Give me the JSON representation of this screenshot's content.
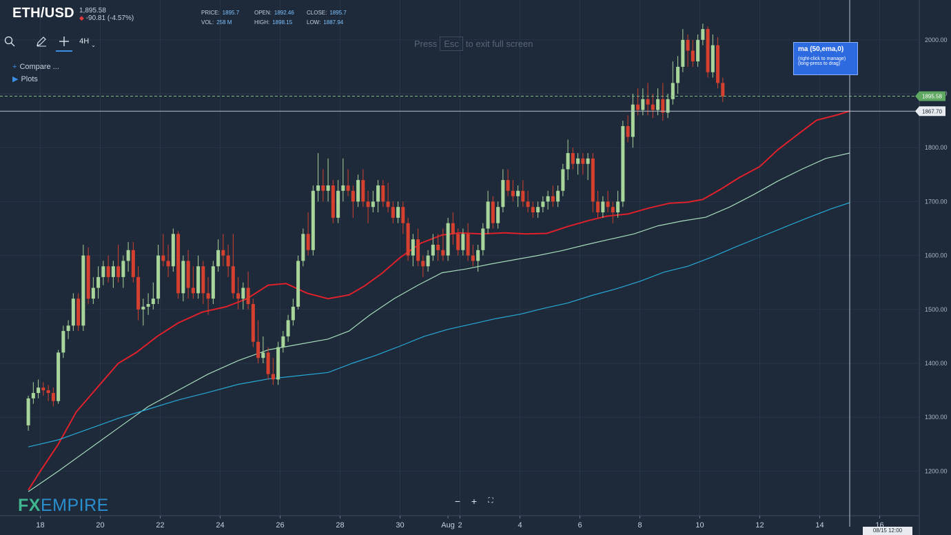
{
  "header": {
    "symbol": "ETH/USD",
    "price": "1,895.58",
    "change": "-90.81 (-4.57%)",
    "change_arrow": "down-arrow-icon",
    "price_label": "PRICE:",
    "price_value": "1895.7",
    "open_label": "OPEN:",
    "open_value": "1892.46",
    "close_label": "CLOSE:",
    "close_value": "1895.7",
    "vol_label": "VOL:",
    "vol_value": "258 M",
    "high_label": "HIGH:",
    "high_value": "1898.15",
    "low_label": "LOW:",
    "low_value": "1887.94"
  },
  "toolbar": {
    "search_icon": "search-icon",
    "draw_icon": "pencil-icon",
    "crosshair_icon": "crosshair-icon",
    "interval": "4H"
  },
  "side": {
    "compare": "Compare ...",
    "plots": "Plots"
  },
  "fullscreen_note": {
    "pre": "Press",
    "key": "Esc",
    "post": "to exit full screen"
  },
  "tooltip": {
    "title": "ma (50,ema,0)",
    "line1": "(right-click to manage)",
    "line2": "(long-press to drag)"
  },
  "logo": {
    "fx": "FX",
    "empire": "EMPIRE"
  },
  "price_tags": {
    "last": "1895.58",
    "crosshair": "1867.70"
  },
  "crosshair_date": "08/15 12:00",
  "colors": {
    "background": "#1e2a3a",
    "up": "#a8d59a",
    "down": "#d6402f",
    "ema50": "#e0202a",
    "ma100": "#a6dcbc",
    "ma200": "#27a9d8"
  },
  "chart_data": {
    "type": "candlestick",
    "ylim": [
      1150,
      2030
    ],
    "y_ticks": [
      1200,
      1300,
      1400,
      1500,
      1600,
      1700,
      1800,
      1900,
      2000
    ],
    "x_ticks": [
      "18",
      "20",
      "22",
      "24",
      "26",
      "28",
      "30",
      "Aug",
      "2",
      "4",
      "6",
      "8",
      "10",
      "12",
      "14",
      "16"
    ],
    "x_tick_days": [
      17,
      19,
      21,
      23,
      25,
      27,
      29,
      30.6,
      31,
      33,
      35,
      37,
      39,
      41,
      43,
      45
    ],
    "grid": true,
    "candle_period_hours": 4,
    "first_candle_day": 16.6,
    "candles": [
      [
        1285,
        1340,
        1275,
        1335
      ],
      [
        1335,
        1365,
        1325,
        1345
      ],
      [
        1345,
        1370,
        1335,
        1355
      ],
      [
        1355,
        1365,
        1340,
        1350
      ],
      [
        1350,
        1360,
        1330,
        1345
      ],
      [
        1345,
        1355,
        1320,
        1330
      ],
      [
        1330,
        1425,
        1325,
        1420
      ],
      [
        1420,
        1470,
        1410,
        1460
      ],
      [
        1460,
        1480,
        1445,
        1470
      ],
      [
        1470,
        1530,
        1460,
        1520
      ],
      [
        1520,
        1530,
        1460,
        1470
      ],
      [
        1470,
        1620,
        1460,
        1600
      ],
      [
        1600,
        1615,
        1510,
        1520
      ],
      [
        1520,
        1560,
        1510,
        1540
      ],
      [
        1540,
        1580,
        1520,
        1560
      ],
      [
        1560,
        1590,
        1545,
        1580
      ],
      [
        1580,
        1600,
        1550,
        1560
      ],
      [
        1560,
        1590,
        1540,
        1580
      ],
      [
        1580,
        1620,
        1550,
        1560
      ],
      [
        1560,
        1600,
        1540,
        1590
      ],
      [
        1590,
        1625,
        1570,
        1610
      ],
      [
        1610,
        1625,
        1550,
        1560
      ],
      [
        1560,
        1580,
        1480,
        1500
      ],
      [
        1500,
        1520,
        1470,
        1505
      ],
      [
        1505,
        1530,
        1490,
        1510
      ],
      [
        1510,
        1550,
        1500,
        1520
      ],
      [
        1520,
        1620,
        1510,
        1600
      ],
      [
        1600,
        1640,
        1580,
        1590
      ],
      [
        1590,
        1620,
        1560,
        1580
      ],
      [
        1580,
        1650,
        1570,
        1640
      ],
      [
        1640,
        1645,
        1520,
        1530
      ],
      [
        1530,
        1600,
        1515,
        1590
      ],
      [
        1590,
        1610,
        1520,
        1540
      ],
      [
        1540,
        1580,
        1520,
        1530
      ],
      [
        1530,
        1600,
        1520,
        1580
      ],
      [
        1580,
        1590,
        1510,
        1530
      ],
      [
        1530,
        1560,
        1490,
        1520
      ],
      [
        1520,
        1590,
        1510,
        1580
      ],
      [
        1580,
        1630,
        1570,
        1610
      ],
      [
        1610,
        1640,
        1580,
        1600
      ],
      [
        1600,
        1620,
        1560,
        1580
      ],
      [
        1580,
        1640,
        1520,
        1530
      ],
      [
        1530,
        1560,
        1500,
        1520
      ],
      [
        1520,
        1550,
        1500,
        1540
      ],
      [
        1540,
        1570,
        1500,
        1510
      ],
      [
        1510,
        1520,
        1430,
        1440
      ],
      [
        1440,
        1480,
        1400,
        1410
      ],
      [
        1410,
        1450,
        1400,
        1420
      ],
      [
        1420,
        1430,
        1370,
        1380
      ],
      [
        1380,
        1410,
        1360,
        1370
      ],
      [
        1370,
        1440,
        1360,
        1430
      ],
      [
        1430,
        1460,
        1420,
        1450
      ],
      [
        1450,
        1490,
        1440,
        1480
      ],
      [
        1480,
        1520,
        1470,
        1505
      ],
      [
        1505,
        1600,
        1500,
        1590
      ],
      [
        1590,
        1650,
        1580,
        1640
      ],
      [
        1640,
        1680,
        1600,
        1610
      ],
      [
        1610,
        1730,
        1600,
        1720
      ],
      [
        1720,
        1790,
        1700,
        1730
      ],
      [
        1730,
        1760,
        1700,
        1720
      ],
      [
        1720,
        1780,
        1700,
        1730
      ],
      [
        1730,
        1740,
        1660,
        1670
      ],
      [
        1670,
        1740,
        1660,
        1720
      ],
      [
        1720,
        1780,
        1700,
        1730
      ],
      [
        1730,
        1760,
        1710,
        1720
      ],
      [
        1720,
        1730,
        1670,
        1700
      ],
      [
        1700,
        1750,
        1690,
        1740
      ],
      [
        1740,
        1760,
        1690,
        1700
      ],
      [
        1700,
        1720,
        1660,
        1690
      ],
      [
        1690,
        1720,
        1680,
        1700
      ],
      [
        1700,
        1740,
        1680,
        1730
      ],
      [
        1730,
        1740,
        1690,
        1700
      ],
      [
        1700,
        1735,
        1680,
        1690
      ],
      [
        1690,
        1700,
        1660,
        1670
      ],
      [
        1670,
        1700,
        1660,
        1690
      ],
      [
        1690,
        1700,
        1640,
        1660
      ],
      [
        1660,
        1670,
        1590,
        1600
      ],
      [
        1600,
        1640,
        1580,
        1630
      ],
      [
        1630,
        1650,
        1580,
        1590
      ],
      [
        1590,
        1600,
        1560,
        1580
      ],
      [
        1580,
        1610,
        1570,
        1600
      ],
      [
        1600,
        1640,
        1590,
        1620
      ],
      [
        1620,
        1640,
        1590,
        1610
      ],
      [
        1610,
        1650,
        1590,
        1600
      ],
      [
        1600,
        1670,
        1590,
        1660
      ],
      [
        1660,
        1680,
        1620,
        1640
      ],
      [
        1640,
        1650,
        1600,
        1610
      ],
      [
        1610,
        1650,
        1600,
        1640
      ],
      [
        1640,
        1660,
        1590,
        1600
      ],
      [
        1600,
        1620,
        1580,
        1590
      ],
      [
        1590,
        1620,
        1570,
        1610
      ],
      [
        1610,
        1660,
        1600,
        1650
      ],
      [
        1650,
        1720,
        1640,
        1700
      ],
      [
        1700,
        1710,
        1650,
        1660
      ],
      [
        1660,
        1700,
        1650,
        1690
      ],
      [
        1690,
        1760,
        1680,
        1740
      ],
      [
        1740,
        1760,
        1710,
        1720
      ],
      [
        1720,
        1740,
        1700,
        1710
      ],
      [
        1710,
        1730,
        1690,
        1720
      ],
      [
        1720,
        1740,
        1690,
        1700
      ],
      [
        1700,
        1720,
        1680,
        1690
      ],
      [
        1690,
        1700,
        1670,
        1680
      ],
      [
        1680,
        1700,
        1670,
        1690
      ],
      [
        1690,
        1710,
        1680,
        1700
      ],
      [
        1700,
        1720,
        1685,
        1710
      ],
      [
        1710,
        1730,
        1690,
        1700
      ],
      [
        1700,
        1730,
        1690,
        1720
      ],
      [
        1720,
        1770,
        1710,
        1760
      ],
      [
        1760,
        1815,
        1740,
        1790
      ],
      [
        1790,
        1800,
        1760,
        1770
      ],
      [
        1770,
        1790,
        1750,
        1780
      ],
      [
        1780,
        1790,
        1750,
        1770
      ],
      [
        1770,
        1790,
        1740,
        1780
      ],
      [
        1780,
        1790,
        1680,
        1700
      ],
      [
        1700,
        1720,
        1670,
        1680
      ],
      [
        1680,
        1710,
        1670,
        1700
      ],
      [
        1700,
        1720,
        1680,
        1690
      ],
      [
        1690,
        1700,
        1660,
        1680
      ],
      [
        1680,
        1720,
        1670,
        1700
      ],
      [
        1700,
        1850,
        1690,
        1840
      ],
      [
        1840,
        1860,
        1810,
        1820
      ],
      [
        1820,
        1900,
        1800,
        1880
      ],
      [
        1880,
        1910,
        1860,
        1870
      ],
      [
        1870,
        1910,
        1860,
        1890
      ],
      [
        1890,
        1920,
        1860,
        1880
      ],
      [
        1880,
        1900,
        1855,
        1870
      ],
      [
        1870,
        1910,
        1860,
        1890
      ],
      [
        1890,
        1920,
        1850,
        1865
      ],
      [
        1865,
        1900,
        1855,
        1890
      ],
      [
        1890,
        1960,
        1880,
        1920
      ],
      [
        1920,
        1970,
        1900,
        1950
      ],
      [
        1950,
        2020,
        1940,
        2000
      ],
      [
        2000,
        2010,
        1950,
        1980
      ],
      [
        1980,
        2000,
        1950,
        1960
      ],
      [
        1960,
        2010,
        1950,
        2000
      ],
      [
        2000,
        2030,
        1990,
        2020
      ],
      [
        2020,
        2025,
        1930,
        1940
      ],
      [
        1940,
        2010,
        1930,
        1990
      ],
      [
        1990,
        2005,
        1910,
        1920
      ],
      [
        1920,
        1930,
        1885,
        1895
      ]
    ],
    "series": [
      {
        "type": "ema",
        "period": 50,
        "color": "#e0202a",
        "values": [
          [
            16.6,
            1165
          ],
          [
            17.0,
            1200
          ],
          [
            17.6,
            1250
          ],
          [
            18.2,
            1310
          ],
          [
            18.9,
            1355
          ],
          [
            19.6,
            1400
          ],
          [
            20.2,
            1420
          ],
          [
            20.9,
            1450
          ],
          [
            21.6,
            1475
          ],
          [
            22.4,
            1495
          ],
          [
            23.2,
            1505
          ],
          [
            23.9,
            1520
          ],
          [
            24.6,
            1545
          ],
          [
            25.2,
            1548
          ],
          [
            25.9,
            1530
          ],
          [
            26.6,
            1520
          ],
          [
            27.3,
            1527
          ],
          [
            27.8,
            1543
          ],
          [
            28.4,
            1567
          ],
          [
            29.0,
            1596
          ],
          [
            29.7,
            1623
          ],
          [
            30.4,
            1638
          ],
          [
            31.0,
            1642
          ],
          [
            31.7,
            1640
          ],
          [
            32.5,
            1642
          ],
          [
            33.2,
            1640
          ],
          [
            33.9,
            1641
          ],
          [
            34.6,
            1654
          ],
          [
            35.3,
            1665
          ],
          [
            35.9,
            1673
          ],
          [
            36.6,
            1677
          ],
          [
            37.3,
            1688
          ],
          [
            38.0,
            1697
          ],
          [
            38.6,
            1699
          ],
          [
            39.1,
            1704
          ],
          [
            39.7,
            1723
          ],
          [
            40.3,
            1744
          ],
          [
            41.0,
            1765
          ],
          [
            41.6,
            1796
          ],
          [
            42.3,
            1826
          ],
          [
            42.9,
            1851
          ],
          [
            43.6,
            1861
          ],
          [
            44.0,
            1868
          ]
        ]
      },
      {
        "type": "sma",
        "period": 100,
        "color": "#a6dcbc",
        "values": [
          [
            16.6,
            1162
          ],
          [
            17.6,
            1200
          ],
          [
            18.6,
            1240
          ],
          [
            19.6,
            1280
          ],
          [
            20.6,
            1320
          ],
          [
            21.6,
            1350
          ],
          [
            22.6,
            1380
          ],
          [
            23.6,
            1405
          ],
          [
            24.6,
            1425
          ],
          [
            25.6,
            1435
          ],
          [
            26.6,
            1445
          ],
          [
            27.3,
            1460
          ],
          [
            28.0,
            1490
          ],
          [
            28.8,
            1520
          ],
          [
            29.6,
            1545
          ],
          [
            30.4,
            1568
          ],
          [
            31.2,
            1575
          ],
          [
            32.0,
            1584
          ],
          [
            32.8,
            1592
          ],
          [
            33.6,
            1600
          ],
          [
            34.4,
            1609
          ],
          [
            35.2,
            1620
          ],
          [
            36.0,
            1630
          ],
          [
            36.8,
            1640
          ],
          [
            37.6,
            1655
          ],
          [
            38.4,
            1664
          ],
          [
            39.2,
            1671
          ],
          [
            40.0,
            1690
          ],
          [
            40.8,
            1713
          ],
          [
            41.6,
            1738
          ],
          [
            42.4,
            1760
          ],
          [
            43.2,
            1780
          ],
          [
            44.0,
            1790
          ]
        ]
      },
      {
        "type": "sma",
        "period": 200,
        "color": "#27a9d8",
        "values": [
          [
            16.6,
            1245
          ],
          [
            17.6,
            1258
          ],
          [
            18.6,
            1278
          ],
          [
            19.6,
            1298
          ],
          [
            20.6,
            1315
          ],
          [
            21.6,
            1332
          ],
          [
            22.6,
            1346
          ],
          [
            23.6,
            1361
          ],
          [
            24.6,
            1371
          ],
          [
            25.6,
            1377
          ],
          [
            26.6,
            1383
          ],
          [
            27.4,
            1400
          ],
          [
            28.2,
            1415
          ],
          [
            29.0,
            1432
          ],
          [
            29.8,
            1450
          ],
          [
            30.6,
            1463
          ],
          [
            31.4,
            1473
          ],
          [
            32.2,
            1483
          ],
          [
            33.0,
            1491
          ],
          [
            33.8,
            1502
          ],
          [
            34.6,
            1512
          ],
          [
            35.4,
            1526
          ],
          [
            36.2,
            1538
          ],
          [
            37.0,
            1552
          ],
          [
            37.8,
            1569
          ],
          [
            38.6,
            1580
          ],
          [
            39.4,
            1597
          ],
          [
            40.2,
            1616
          ],
          [
            41.0,
            1634
          ],
          [
            41.8,
            1652
          ],
          [
            42.6,
            1670
          ],
          [
            43.4,
            1687
          ],
          [
            44.0,
            1698
          ]
        ]
      }
    ]
  }
}
